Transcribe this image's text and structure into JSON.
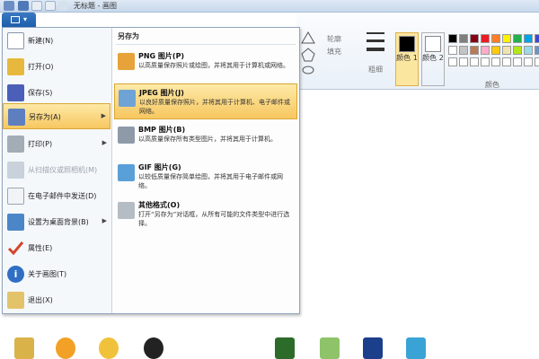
{
  "window": {
    "title": "无标题 - 画图"
  },
  "ribbon": {
    "outline_label": "轮廓",
    "fill_label": "填充",
    "thickness_label": "粗细",
    "color1_label": "颜色 1",
    "color2_label": "颜色 2",
    "colors_group_label": "颜色",
    "color1_value": "#000000",
    "color2_value": "#ffffff",
    "palette_row1": [
      "#000000",
      "#7f7f7f",
      "#880015",
      "#ed1c24",
      "#ff7f27",
      "#fff200",
      "#22b14c",
      "#00a2e8",
      "#3f48cc",
      "#a349a4"
    ],
    "palette_row2": [
      "#ffffff",
      "#c3c3c3",
      "#b97a57",
      "#ffaec9",
      "#ffc90e",
      "#efe4b0",
      "#b5e61d",
      "#99d9ea",
      "#7092be",
      "#c8bfe7"
    ],
    "palette_row3": [
      "#ffffff",
      "#ffffff",
      "#ffffff",
      "#ffffff",
      "#ffffff",
      "#ffffff",
      "#ffffff",
      "#ffffff",
      "#ffffff",
      "#ffffff"
    ]
  },
  "menu": {
    "items": [
      {
        "label": "新建(N)"
      },
      {
        "label": "打开(O)"
      },
      {
        "label": "保存(S)"
      },
      {
        "label": "另存为(A)"
      },
      {
        "label": "打印(P)"
      },
      {
        "label": "从扫描仪或照相机(M)"
      },
      {
        "label": "在电子邮件中发送(D)"
      },
      {
        "label": "设置为桌面背景(B)"
      },
      {
        "label": "属性(E)"
      },
      {
        "label": "关于画图(T)"
      },
      {
        "label": "退出(X)"
      }
    ]
  },
  "submenu": {
    "title": "另存为",
    "items": [
      {
        "title": "PNG 图片(P)",
        "desc": "以高质量保存照片或绘图，并将其用于计算机或网络。"
      },
      {
        "title": "JPEG 图片(J)",
        "desc": "以良好质量保存照片，并将其用于计算机、电子邮件或网络。"
      },
      {
        "title": "BMP 图片(B)",
        "desc": "以高质量保存所有类型图片，并将其用于计算机。"
      },
      {
        "title": "GIF 图片(G)",
        "desc": "以较低质量保存简单绘图，并将其用于电子邮件或网络。"
      },
      {
        "title": "其他格式(O)",
        "desc": "打开“另存为”对话框，从所有可能的文件类型中进行选择。"
      }
    ]
  }
}
